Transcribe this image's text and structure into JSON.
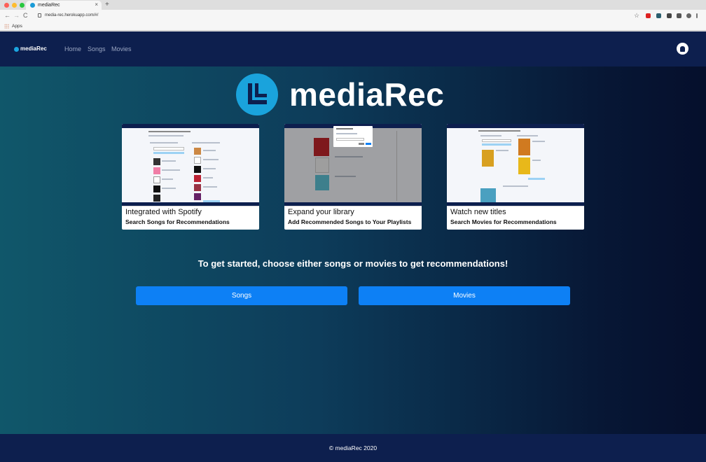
{
  "browser": {
    "tab_title": "mediaRec",
    "tab_close": "×",
    "new_tab": "+",
    "back": "←",
    "forward": "→",
    "reload": "C",
    "url": "media-rec.herokuapp.com/#/",
    "star": "☆",
    "bookmarks_label": "Apps"
  },
  "navbar": {
    "brand": "mediaRec",
    "links": [
      "Home",
      "Songs",
      "Movies"
    ]
  },
  "hero": {
    "title": "mediaRec"
  },
  "cards": [
    {
      "title": "Integrated with Spotify",
      "subtitle": "Search Songs for Recommendations"
    },
    {
      "title": "Expand your library",
      "subtitle": "Add Recommended Songs to Your Playlists"
    },
    {
      "title": "Watch new titles",
      "subtitle": "Search Movies for Recommendations"
    }
  ],
  "cta": "To get started, choose either songs or movies to get recommendations!",
  "buttons": {
    "songs": "Songs",
    "movies": "Movies"
  },
  "footer": "© mediaRec 2020",
  "colors": {
    "navbar": "#0d1f4e",
    "accent": "#1aa3dc",
    "button": "#0d80f5"
  }
}
